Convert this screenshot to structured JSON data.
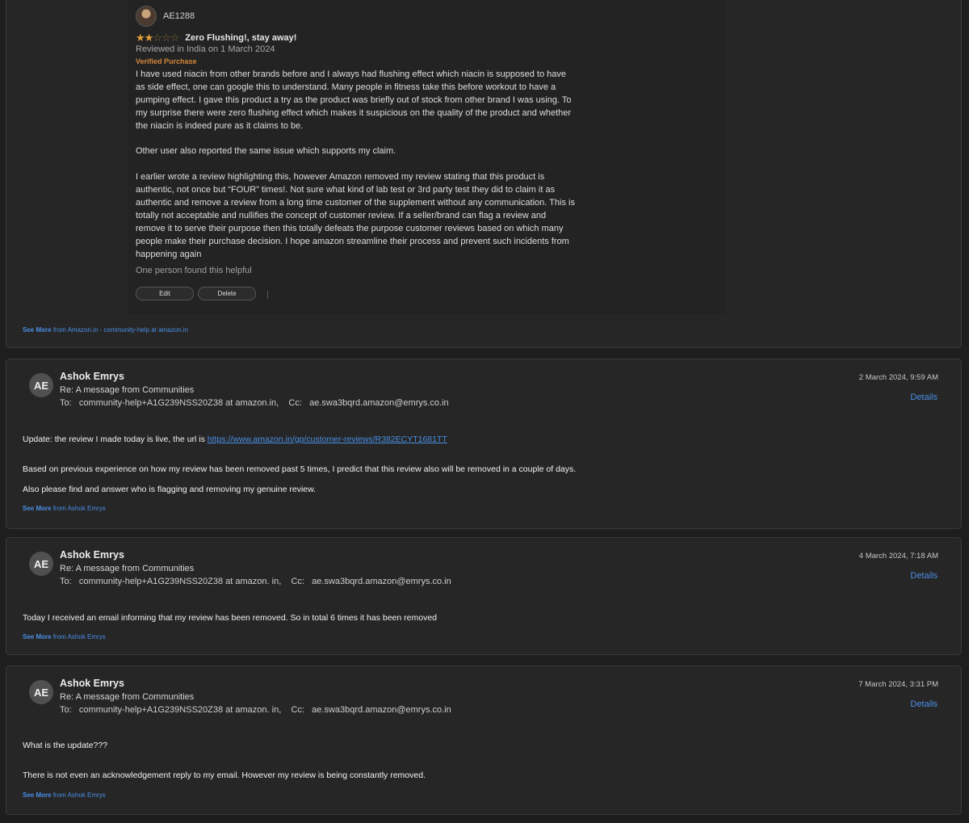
{
  "review_card": {
    "reviewer_name": "AE1288",
    "rating": 2,
    "rating_max": 5,
    "review_title": "Zero Flushing!, stay away!",
    "reviewed_line": "Reviewed in India on 1 March 2024",
    "verified": "Verified Purchase",
    "body_paragraphs": [
      "I have used niacin from other brands before and I always had flushing effect which niacin is supposed to have as side effect, one can google this to understand. Many people in fitness take this before workout to have a pumping effect. I gave this product a try as the product was briefly out of stock from other brand I was using. To my surprise there were zero flushing effect which makes it suspicious on the quality of the product and whether the niacin is indeed pure as it claims to be.",
      "Other user also reported the same issue which supports my claim.",
      "I earlier wrote a review highlighting this, however Amazon removed my review stating that this product is authentic, not once but “FOUR” times!. Not sure what kind of lab test or 3rd party test they did to claim it as authentic and remove a review from a long time customer of the supplement without any communication. This is totally not acceptable and nullifies the concept of customer review. If a seller/brand can flag a review and remove it to serve their purpose then this totally defeats the purpose customer reviews based on which many people make their purchase decision.  I hope amazon streamline their process and prevent such incidents from happening again"
    ],
    "helpful_text": "One person found this helpful",
    "edit_label": "Edit",
    "delete_label": "Delete",
    "see_more_label": "See More",
    "see_more_from": "from Amazon.in - community-help at amazon.in"
  },
  "messages": [
    {
      "avatar": "AE",
      "sender": "Ashok Emrys",
      "subject": "Re: A message from Communities",
      "to_label": "To:",
      "to_value": "community-help+A1G239NSS20Z38 at amazon.in,",
      "cc_label": "Cc:",
      "cc_value": "ae.swa3bqrd.amazon@emrys.co.in",
      "date": "2 March 2024, 9:59 AM",
      "details_label": "Details",
      "line1_prefix": "Update: the review I made today is live, the url is ",
      "line1_link": "https://www.amazon.in/gp/customer-reviews/R382ECYT1681TT",
      "line2": "Based on previous experience on how my review has been removed past 5 times, I predict that this review also will be removed in a couple of days.",
      "line3": "Also please find and answer who is flagging and removing my genuine review.",
      "see_more_label": "See More",
      "see_more_from": "from Ashok Emrys"
    },
    {
      "avatar": "AE",
      "sender": "Ashok Emrys",
      "subject": "Re: A message from Communities",
      "to_label": "To:",
      "to_value": "community-help+A1G239NSS20Z38 at amazon. in,",
      "cc_label": "Cc:",
      "cc_value": "ae.swa3bqrd.amazon@emrys.co.in",
      "date": "4 March 2024, 7:18 AM",
      "details_label": "Details",
      "line1": "Today I received an email informing that my review has been removed. So in total 6 times it has been removed",
      "see_more_label": "See More",
      "see_more_from": "from Ashok Emrys"
    },
    {
      "avatar": "AE",
      "sender": "Ashok Emrys",
      "subject": "Re: A message from Communities",
      "to_label": "To:",
      "to_value": "community-help+A1G239NSS20Z38 at amazon. in,",
      "cc_label": "Cc:",
      "cc_value": "ae.swa3bqrd.amazon@emrys.co.in",
      "date": "7 March 2024, 3:31 PM",
      "details_label": "Details",
      "line1": "What is the update???",
      "line2": "There is not even an acknowledgement reply to my email. However my review is being constantly removed.",
      "see_more_label": "See More",
      "see_more_from": "from Ashok Emrys"
    }
  ]
}
